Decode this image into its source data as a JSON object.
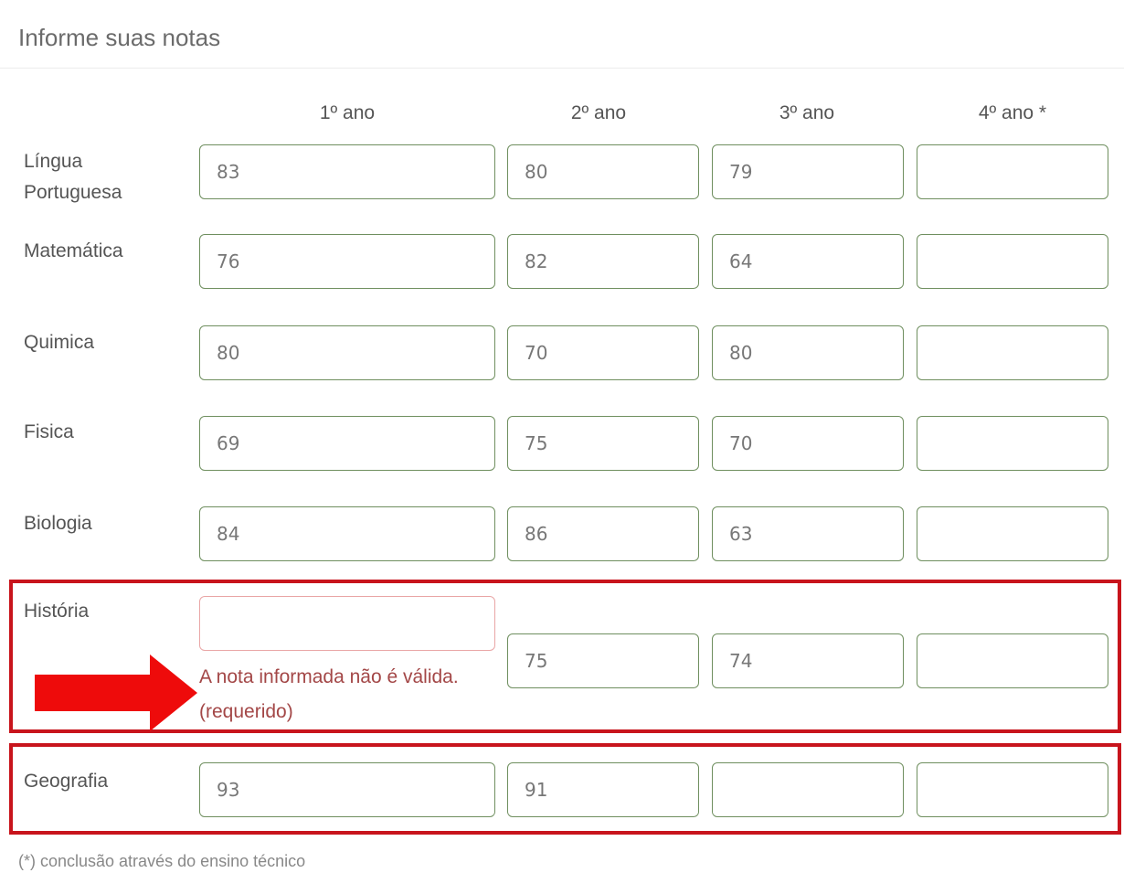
{
  "header": {
    "title": "Informe suas notas"
  },
  "columns": [
    "1º ano",
    "2º ano",
    "3º ano",
    "4º ano *"
  ],
  "rows": [
    {
      "label_lines": [
        "Língua",
        "Portuguesa"
      ],
      "grades": [
        "83",
        "80",
        "79",
        ""
      ]
    },
    {
      "label_lines": [
        "Matemática"
      ],
      "grades": [
        "76",
        "82",
        "64",
        ""
      ]
    },
    {
      "label_lines": [
        "Quimica"
      ],
      "grades": [
        "80",
        "70",
        "80",
        ""
      ]
    },
    {
      "label_lines": [
        "Fisica"
      ],
      "grades": [
        "69",
        "75",
        "70",
        ""
      ]
    },
    {
      "label_lines": [
        "Biologia"
      ],
      "grades": [
        "84",
        "86",
        "63",
        ""
      ]
    },
    {
      "label_lines": [
        "História"
      ],
      "grades": [
        "",
        "75",
        "74",
        ""
      ]
    },
    {
      "label_lines": [
        "Geografia"
      ],
      "grades": [
        "93",
        "91",
        "",
        ""
      ]
    }
  ],
  "validation": {
    "message": "A nota informada não é válida.",
    "required": "(requerido)"
  },
  "footnote": "(*) conclusão através do ensino técnico",
  "colors": {
    "highlight": "#c8141c",
    "arrow": "#ee0b0b",
    "input_border": "#6f8f5f",
    "error_text": "#a34747"
  }
}
